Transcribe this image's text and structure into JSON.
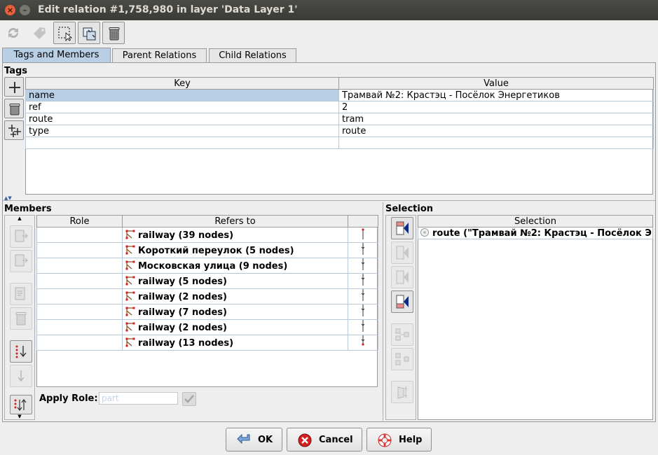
{
  "window": {
    "title": "Edit relation #1,758,980 in layer 'Data Layer 1'"
  },
  "toolbar": {
    "icons": [
      "refresh-icon",
      "apply-preset-icon",
      "select-icon",
      "zoom-to-icon",
      "delete-icon"
    ]
  },
  "tabs": [
    {
      "label": "Tags and Members",
      "active": true
    },
    {
      "label": "Parent Relations",
      "active": false
    },
    {
      "label": "Child Relations",
      "active": false
    }
  ],
  "tags": {
    "title": "Tags",
    "columns": [
      "Key",
      "Value"
    ],
    "rows": [
      {
        "key": "name",
        "value": "Трамвай №2: Крастэц - Посёлок Энергетиков"
      },
      {
        "key": "ref",
        "value": "2"
      },
      {
        "key": "route",
        "value": "tram"
      },
      {
        "key": "type",
        "value": "route"
      },
      {
        "key": "",
        "value": ""
      }
    ]
  },
  "members": {
    "title": "Members",
    "columns": [
      "Role",
      "Refers to",
      ""
    ],
    "rows": [
      {
        "role": "",
        "refers": "railway (39 nodes)"
      },
      {
        "role": "",
        "refers": "Короткий переулок (5 nodes)"
      },
      {
        "role": "",
        "refers": "Московская улица (9 nodes)"
      },
      {
        "role": "",
        "refers": "railway (5 nodes)"
      },
      {
        "role": "",
        "refers": "railway (2 nodes)"
      },
      {
        "role": "",
        "refers": "railway (7 nodes)"
      },
      {
        "role": "",
        "refers": "railway (2 nodes)"
      },
      {
        "role": "",
        "refers": "railway (13 nodes)"
      }
    ],
    "apply_role_label": "Apply Role:",
    "apply_role_placeholder": "part"
  },
  "selection": {
    "title": "Selection",
    "column": "Selection",
    "rows": [
      "route (\"Трамвай №2: Крастэц - Посёлок Э..."
    ]
  },
  "buttons": {
    "ok": "OK",
    "cancel": "Cancel",
    "help": "Help"
  },
  "colors": {
    "selected_row": "#b8cfe5",
    "title_bar": "#3c3b37",
    "node_red": "#cc2222"
  }
}
